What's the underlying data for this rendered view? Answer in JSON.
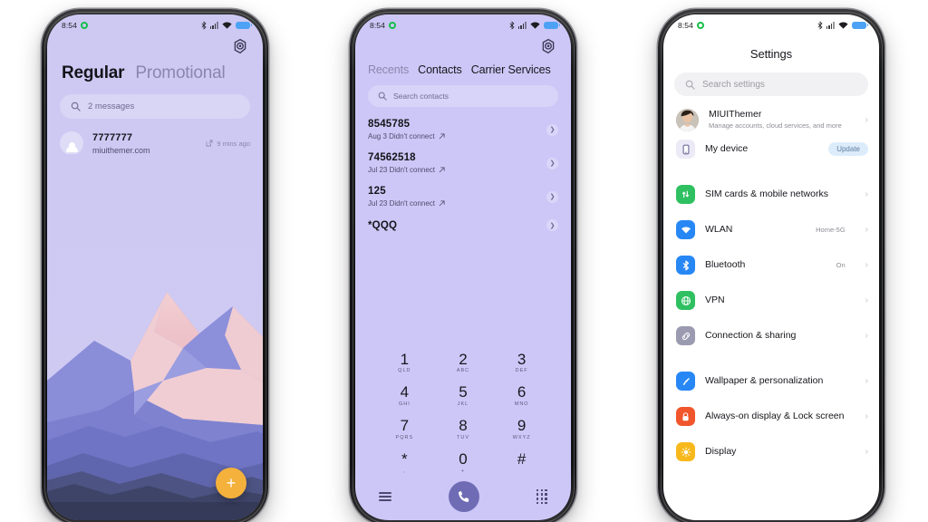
{
  "theme": {
    "msg_bg": "#cdc9f3",
    "dial_bg": "#cdc7f7",
    "settings_bg": "#ffffff",
    "accent_purple": "#6f6cb5",
    "fab_orange": "#f4b13b",
    "battery_blue": "#4da2f5",
    "status_dot_green": "#14c04a"
  },
  "statusbar": {
    "time": "8:54",
    "dot_icon": "record-dot-icon",
    "bluetooth_icon": "bluetooth-icon",
    "signal_icon": "cellular-signal-icon",
    "wifi_icon": "wifi-icon",
    "battery_icon": "battery-icon"
  },
  "phone1": {
    "gear_icon": "gear-icon",
    "tabs": [
      {
        "label": "Regular",
        "active": true
      },
      {
        "label": "Promotional",
        "active": false
      }
    ],
    "search": {
      "icon": "search-icon",
      "value": "2 messages"
    },
    "message": {
      "avatar_icon": "person-avatar-icon",
      "name": "7777777",
      "preview": "miuithemer.com",
      "meta_icon": "external-link-icon",
      "time": "9 mins ago"
    },
    "fab": {
      "icon": "plus-icon",
      "label": "+"
    }
  },
  "phone2": {
    "gear_icon": "gear-icon",
    "tabs": [
      {
        "label": "Recents",
        "active": false
      },
      {
        "label": "Contacts",
        "active": true
      },
      {
        "label": "Carrier Services",
        "active": true
      }
    ],
    "search": {
      "icon": "search-icon",
      "placeholder": "Search contacts"
    },
    "calls": [
      {
        "number": "8545785",
        "detail": "Aug 3 Didn't connect",
        "arrow_icon": "outgoing-call-arrow-icon"
      },
      {
        "number": "74562518",
        "detail": "Jul 23 Didn't connect",
        "arrow_icon": "outgoing-call-arrow-icon"
      },
      {
        "number": "125",
        "detail": "Jul 23 Didn't connect",
        "arrow_icon": "outgoing-call-arrow-icon"
      },
      {
        "number": "*QQQ",
        "detail": "",
        "arrow_icon": "outgoing-call-arrow-icon"
      }
    ],
    "keypad": [
      {
        "digit": "1",
        "letters": "QLD"
      },
      {
        "digit": "2",
        "letters": "ABC"
      },
      {
        "digit": "3",
        "letters": "DEF"
      },
      {
        "digit": "4",
        "letters": "GHI"
      },
      {
        "digit": "5",
        "letters": "JKL"
      },
      {
        "digit": "6",
        "letters": "MNO"
      },
      {
        "digit": "7",
        "letters": "PQRS"
      },
      {
        "digit": "8",
        "letters": "TUV"
      },
      {
        "digit": "9",
        "letters": "WXYZ"
      },
      {
        "digit": "*",
        "letters": ","
      },
      {
        "digit": "0",
        "letters": "+"
      },
      {
        "digit": "#",
        "letters": ""
      }
    ],
    "bottom": {
      "menu_icon": "hamburger-menu-icon",
      "call_icon": "phone-call-icon",
      "keypad_icon": "dialpad-icon"
    }
  },
  "phone3": {
    "title": "Settings",
    "search": {
      "icon": "search-icon",
      "placeholder": "Search settings"
    },
    "account": {
      "avatar_icon": "user-photo-avatar",
      "name": "MIUIThemer",
      "subtitle": "Manage accounts, cloud services, and more",
      "chevron_icon": "chevron-right-icon"
    },
    "device": {
      "icon": "device-icon",
      "icon_color": "#eceaf7",
      "label": "My device",
      "badge": "Update"
    },
    "group_network": [
      {
        "label": "SIM cards & mobile networks",
        "value": "",
        "icon": "sim-card-icon",
        "color": "#2fc061"
      },
      {
        "label": "WLAN",
        "value": "Home-5G",
        "icon": "wifi-icon",
        "color": "#2787f5"
      },
      {
        "label": "Bluetooth",
        "value": "On",
        "icon": "bluetooth-icon",
        "color": "#2787f5"
      },
      {
        "label": "VPN",
        "value": "",
        "icon": "globe-vpn-icon",
        "color": "#2fc061"
      },
      {
        "label": "Connection & sharing",
        "value": "",
        "icon": "connection-share-icon",
        "color": "#9a9ab0"
      }
    ],
    "group_personal": [
      {
        "label": "Wallpaper & personalization",
        "value": "",
        "icon": "wallpaper-brush-icon",
        "color": "#2787f5"
      },
      {
        "label": "Always-on display & Lock screen",
        "value": "",
        "icon": "lock-screen-icon",
        "color": "#f0552b"
      },
      {
        "label": "Display",
        "value": "",
        "icon": "brightness-icon",
        "color": "#f7b81c"
      }
    ],
    "chevron_icon": "chevron-right-icon"
  }
}
